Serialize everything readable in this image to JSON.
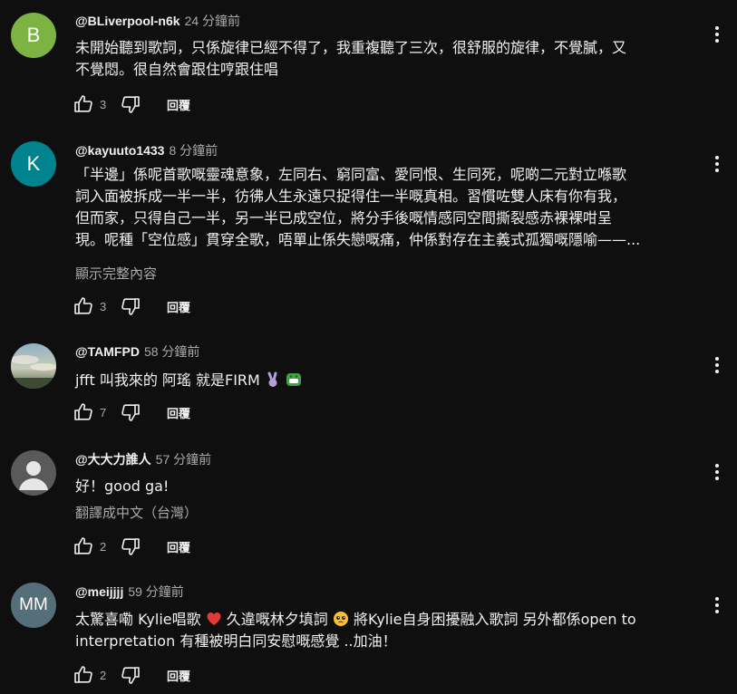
{
  "labels": {
    "reply": "回覆"
  },
  "comments": [
    {
      "author": "@BLiverpool-n6k",
      "time": "24 分鐘前",
      "avatar_text": "B",
      "avatar_color": "#7cb342",
      "text_lines": [
        "未開始聽到歌詞，只係旋律已經不得了，我重複聽了三次，很舒服的旋律，不覺膩，又",
        "不覺悶。很自然會跟住哼跟住唱"
      ],
      "likes": "3"
    },
    {
      "author": "@kayuuto1433",
      "time": "8 分鐘前",
      "avatar_text": "K",
      "avatar_color": "#00838f",
      "text_lines": [
        "「半邊」係呢首歌嘅靈魂意象，左同右、窮同富、愛同恨、生同死，呢啲二元對立喺歌",
        "詞入面被拆成一半一半，彷彿人生永遠只捉得住一半嘅真相。習慣咗雙人床有你有我，",
        "但而家，只得自己一半，另一半已成空位，將分手後嘅情感同空間撕裂感赤裸裸咁呈",
        "現。呢種「空位感」貫穿全歌，唔單止係失戀嘅痛，仲係對存在主義式孤獨嘅隱喻——..."
      ],
      "read_more": "顯示完整內容",
      "likes": "3"
    },
    {
      "author": "@TAMFPD",
      "time": "58 分鐘前",
      "avatar_text": "",
      "avatar_color": "#6f8fa3",
      "text_lines": [
        "jfft 叫我來的 阿瑤  就是FIRM"
      ],
      "emojis": [
        "victory-hand-emoji",
        "grinning-green-emoji"
      ],
      "likes": "7"
    },
    {
      "author": "@大大力誰人",
      "time": "57 分鐘前",
      "avatar_text": "",
      "avatar_color": "#5a5a5a",
      "text_lines": [
        "好！good ga!"
      ],
      "translate": "翻譯成中文（台灣）",
      "likes": "2"
    },
    {
      "author": "@meijjjj",
      "time": "59 分鐘前",
      "avatar_text": "MM",
      "avatar_color": "#546e7a",
      "text_lines": [
        "太驚喜嘞 Kylie唱歌",
        "interpretation 有種被明白同安慰嘅感覺 ..加油！"
      ],
      "text_mid_1": " 久違嘅林夕填詞",
      "text_mid_2": " 將Kylie自身困擾融入歌詞  另外都係open to",
      "likes": "2"
    }
  ]
}
